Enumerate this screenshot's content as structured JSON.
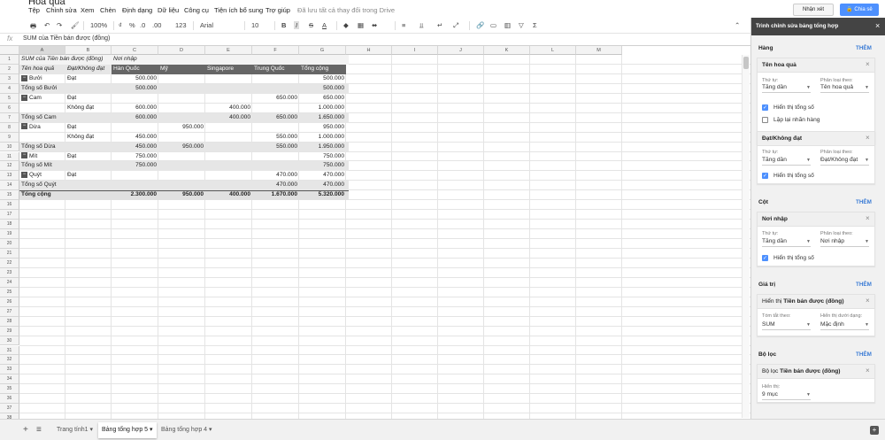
{
  "doc": {
    "title": "Hoa quả"
  },
  "menu": [
    "Tệp",
    "Chỉnh sửa",
    "Xem",
    "Chèn",
    "Định dạng",
    "Dữ liệu",
    "Công cụ",
    "Tiện ích bổ sung",
    "Trợ giúp"
  ],
  "save_status": "Đã lưu tất cả thay đổi trong Drive",
  "header_buttons": {
    "comments": "Nhận xét",
    "share": "Chia sẻ"
  },
  "toolbar": {
    "zoom": "100%",
    "currency": "₫",
    "percent": "%",
    "dec_less": ".0",
    "dec_more": ".00",
    "more_formats": "123",
    "font": "Arial",
    "font_size": "10",
    "bold": "B",
    "italic": "I",
    "strike": "S",
    "text_color": "A"
  },
  "formula": {
    "fx": "fx",
    "content": "SUM của Tiền bán được (đồng)"
  },
  "columns": [
    "A",
    "B",
    "C",
    "D",
    "E",
    "F",
    "G",
    "H",
    "I",
    "J",
    "K",
    "L",
    "M"
  ],
  "rows": [
    "1",
    "2",
    "3",
    "4",
    "5",
    "6",
    "7",
    "8",
    "9",
    "10",
    "11",
    "12",
    "13",
    "14",
    "15",
    "16",
    "17",
    "18",
    "19",
    "20",
    "21",
    "22",
    "23",
    "24",
    "25",
    "26",
    "27",
    "28",
    "29",
    "30",
    "31",
    "32",
    "33",
    "34",
    "35",
    "36",
    "37",
    "38"
  ],
  "pivot": {
    "r1": {
      "a": "SUM của Tiền bán được (đồng)",
      "c": "Nơi nhập"
    },
    "r2": {
      "a": "Tên hoa quả",
      "b": "Đạt/Không đạt",
      "c": "Hàn Quốc",
      "d": "Mỹ",
      "e": "Singapore",
      "f": "Trung Quốc",
      "g": "Tổng cộng"
    },
    "r3": {
      "a": "Bưởi",
      "b": "Đạt",
      "c": "500.000",
      "g": "500.000"
    },
    "r4": {
      "a": "Tổng số Bưởi",
      "c": "500.000",
      "g": "500.000"
    },
    "r5": {
      "a": "Cam",
      "b": "Đạt",
      "f": "650.000",
      "g": "650.000"
    },
    "r6": {
      "b": "Không đạt",
      "c": "600.000",
      "e": "400.000",
      "g": "1.000.000"
    },
    "r7": {
      "a": "Tổng số Cam",
      "c": "600.000",
      "e": "400.000",
      "f": "650.000",
      "g": "1.650.000"
    },
    "r8": {
      "a": "Dừa",
      "b": "Đạt",
      "d": "950.000",
      "g": "950.000"
    },
    "r9": {
      "b": "Không đạt",
      "c": "450.000",
      "f": "550.000",
      "g": "1.000.000"
    },
    "r10": {
      "a": "Tổng số Dừa",
      "c": "450.000",
      "d": "950.000",
      "f": "550.000",
      "g": "1.950.000"
    },
    "r11": {
      "a": "Mít",
      "b": "Đạt",
      "c": "750.000",
      "g": "750.000"
    },
    "r12": {
      "a": "Tổng số Mít",
      "c": "750.000",
      "g": "750.000"
    },
    "r13": {
      "a": "Quýt",
      "b": "Đạt",
      "f": "470.000",
      "g": "470.000"
    },
    "r14": {
      "a": "Tổng số Quýt",
      "f": "470.000",
      "g": "470.000"
    },
    "r15": {
      "a": "Tổng cộng",
      "c": "2.300.000",
      "d": "950.000",
      "e": "400.000",
      "f": "1.670.000",
      "g": "5.320.000"
    }
  },
  "sheet_tabs": [
    "Trang tính1",
    "Bảng tổng hợp 5",
    "Bảng tổng hợp 4"
  ],
  "panel": {
    "title": "Trình chỉnh sửa bảng tổng hợp",
    "add_label": "THÊM",
    "rows_label": "Hàng",
    "row_card1": {
      "title": "Tên hoa quả",
      "order_label": "Thứ tự:",
      "order_value": "Tăng dần",
      "sortby_label": "Phân loại theo:",
      "sortby_value": "Tên hoa quả",
      "show_totals": "Hiển thị tổng số",
      "repeat_labels": "Lặp lại nhãn hàng"
    },
    "row_card2": {
      "title": "Đạt/Không đạt",
      "order_label": "Thứ tự:",
      "order_value": "Tăng dần",
      "sortby_label": "Phân loại theo:",
      "sortby_value": "Đạt/Không đạt",
      "show_totals": "Hiển thị tổng số"
    },
    "cols_label": "Cột",
    "col_card": {
      "title": "Nơi nhập",
      "order_label": "Thứ tự:",
      "order_value": "Tăng dần",
      "sortby_label": "Phân loại theo:",
      "sortby_value": "Nơi nhập",
      "show_totals": "Hiển thị tổng số"
    },
    "values_label": "Giá trị",
    "value_card": {
      "title_prefix": "Hiển thị ",
      "title_field": "Tiền bán được (đồng)",
      "summarize_label": "Tóm tắt theo:",
      "summarize_value": "SUM",
      "showas_label": "Hiển thị dưới dạng:",
      "showas_value": "Mặc định"
    },
    "filter_label": "Bộ lọc",
    "filter_card": {
      "title_prefix": "Bộ lọc ",
      "title_field": "Tiền bán được (đồng)",
      "show_label": "Hiển thị:",
      "show_value": "9 mục"
    }
  }
}
